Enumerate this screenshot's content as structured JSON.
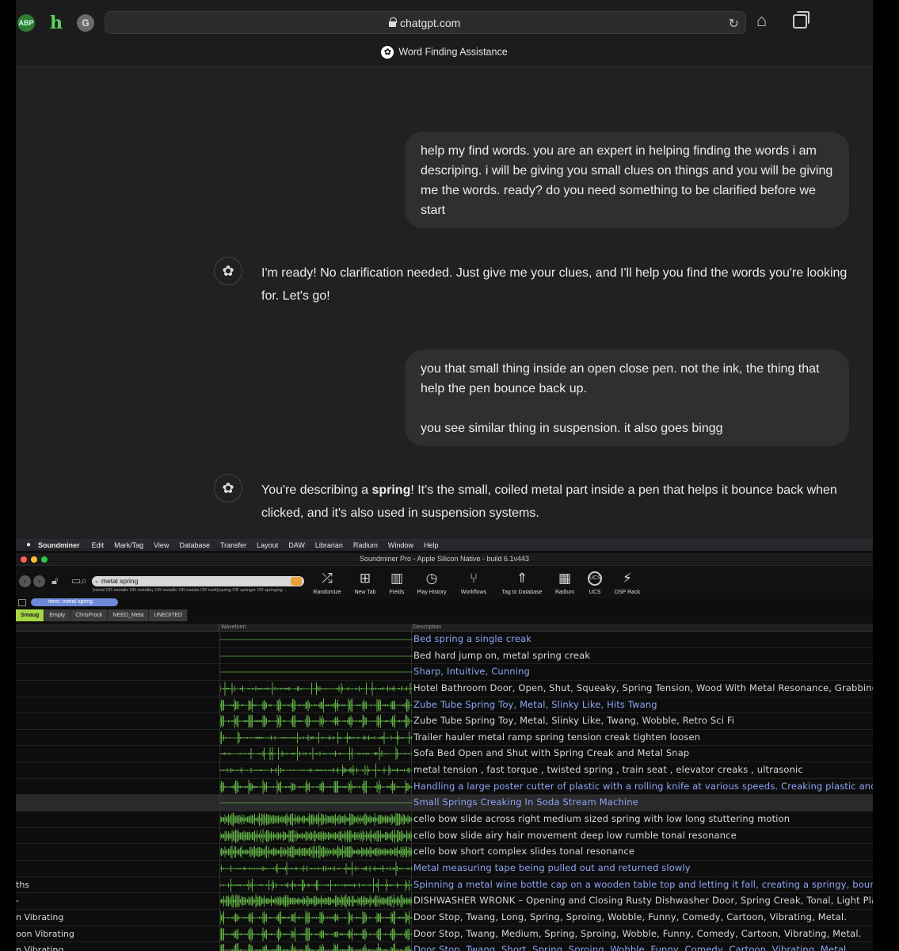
{
  "browser": {
    "extensions": [
      "ABP",
      "h",
      "G"
    ],
    "url": "chatgpt.com",
    "tab_title": "Word Finding Assistance"
  },
  "chat": {
    "user1": "help my find words. you are an expert in helping finding the words i am descriping. i will be giving you small clues on things and you will be giving me the words. ready? do you need something to be clarified before we start",
    "assistant1": "I'm ready! No clarification needed. Just give me your clues, and I'll help you find the words you're looking for. Let's go!",
    "user2_line1": "you that small thing inside an open close pen. not the ink, the thing that help the pen bounce back up.",
    "user2_line2": "you see similar thing in suspension. it also goes bingg",
    "assistant2_pre": "You're describing a ",
    "assistant2_bold": "spring",
    "assistant2_post": "! It's the small, coiled metal part inside a pen that helps it bounce back when clicked, and it's also used in suspension systems."
  },
  "soundminer": {
    "menubar": [
      "Soundminer",
      "Edit",
      "Mark/Tag",
      "View",
      "Database",
      "Transfer",
      "Layout",
      "DAW",
      "Librarian",
      "Radium",
      "Window",
      "Help"
    ],
    "window_title": "Soundminer Pro - Apple Silicon Native - build 6.1v443",
    "search_value": "metal spring",
    "search_detail": "(metal OR metallic OR metalley OR metallic OR metals OR metl)(spring OR springer OR springing ...",
    "toolbar": {
      "randomize": "Randomize",
      "new_tab": "New Tab",
      "fields": "Fields",
      "play_history": "Play History",
      "workflows": "Workflows",
      "tag_db": "Tag to Database",
      "radium": "Radium",
      "ucs": "UCS",
      "ucs_icon_text": "UCS",
      "dsp_rack": "DSP Rack"
    },
    "search_chip": "term: metal spring",
    "db_tabs": [
      "Smaug",
      "Empty",
      "ChrisProck",
      "NEED_Meta",
      "UNEDITED"
    ],
    "columns": {
      "waveform": "Waveform",
      "description": "Description"
    },
    "rows": [
      {
        "name": "",
        "desc": "Bed spring a single creak",
        "hi": true,
        "wave": 0
      },
      {
        "name": "",
        "desc": "Bed hard jump on, metal spring creak",
        "hi": false,
        "wave": 0
      },
      {
        "name": "",
        "desc": "Sharp, Intuitive, Cunning",
        "hi": true,
        "wave": 0
      },
      {
        "name": "",
        "desc": "Hotel Bathroom Door, Open, Shut, Squeaky, Spring Tension, Wood With Metal Resonance, Grabbing Metal",
        "hi": false,
        "wave": 1
      },
      {
        "name": "",
        "desc": "Zube Tube Spring Toy, Metal, Slinky Like, Hits Twang",
        "hi": true,
        "wave": 2
      },
      {
        "name": "",
        "desc": "Zube Tube Spring Toy, Metal, Slinky Like, Twang, Wobble, Retro Sci Fi",
        "hi": false,
        "wave": 2
      },
      {
        "name": "",
        "desc": "Trailer hauler metal ramp spring tension creak tighten loosen",
        "hi": false,
        "wave": 1
      },
      {
        "name": "",
        "desc": "Sofa Bed Open and Shut with Spring Creak and Metal Snap",
        "hi": false,
        "wave": 1
      },
      {
        "name": "",
        "desc": "metal tension , fast torque , twisted spring , train seat , elevator creaks , ultrasonic",
        "hi": false,
        "wave": 1
      },
      {
        "name": "",
        "desc": "Handling a large poster cutter of plastic with a rolling knife at various speeds. Creaking plastic and metal",
        "hi": true,
        "wave": 2
      },
      {
        "name": "",
        "desc": "Small Springs Creaking In Soda Stream Machine",
        "hi": true,
        "wave": 0,
        "selected": true
      },
      {
        "name": "",
        "desc": "cello bow slide across right medium sized spring with low long stuttering motion",
        "hi": false,
        "wave": 3
      },
      {
        "name": "",
        "desc": "cello bow slide airy hair movement deep low rumble tonal resonance",
        "hi": false,
        "wave": 3
      },
      {
        "name": "",
        "desc": "cello bow short complex slides tonal resonance",
        "hi": false,
        "wave": 3
      },
      {
        "name": "",
        "desc": "Metal measuring tape being pulled out and returned slowly",
        "hi": true,
        "wave": 1
      },
      {
        "name": "ths",
        "desc": "Spinning a metal wine bottle cap on a wooden table top and letting it fall, creating a springy, bouncing so",
        "hi": true,
        "wave": 1
      },
      {
        "name": "-",
        "desc": "DISHWASHER WRONK – Opening and Closing Rusty Dishwasher Door, Spring Creak, Tonal, Light Plastic Th",
        "hi": false,
        "wave": 3
      },
      {
        "name": "n Vibrating",
        "desc": "Door Stop, Twang, Long, Spring, Sproing, Wobble, Funny, Comedy, Cartoon, Vibrating, Metal.",
        "hi": false,
        "wave": 2
      },
      {
        "name": "oon Vibrating",
        "desc": "Door Stop, Twang, Medium, Spring, Sproing, Wobble, Funny, Comedy, Cartoon, Vibrating, Metal.",
        "hi": false,
        "wave": 2
      },
      {
        "name": "n Vibrating",
        "desc": "Door Stop, Twang, Short, Spring, Sproing, Wobble, Funny, Comedy, Cartoon, Vibrating, Metal.",
        "hi": true,
        "wave": 2
      }
    ]
  },
  "colors": {
    "accent_green": "#a5d646",
    "link_blue": "#8fa5f5",
    "wave_green": "#5fae45"
  }
}
